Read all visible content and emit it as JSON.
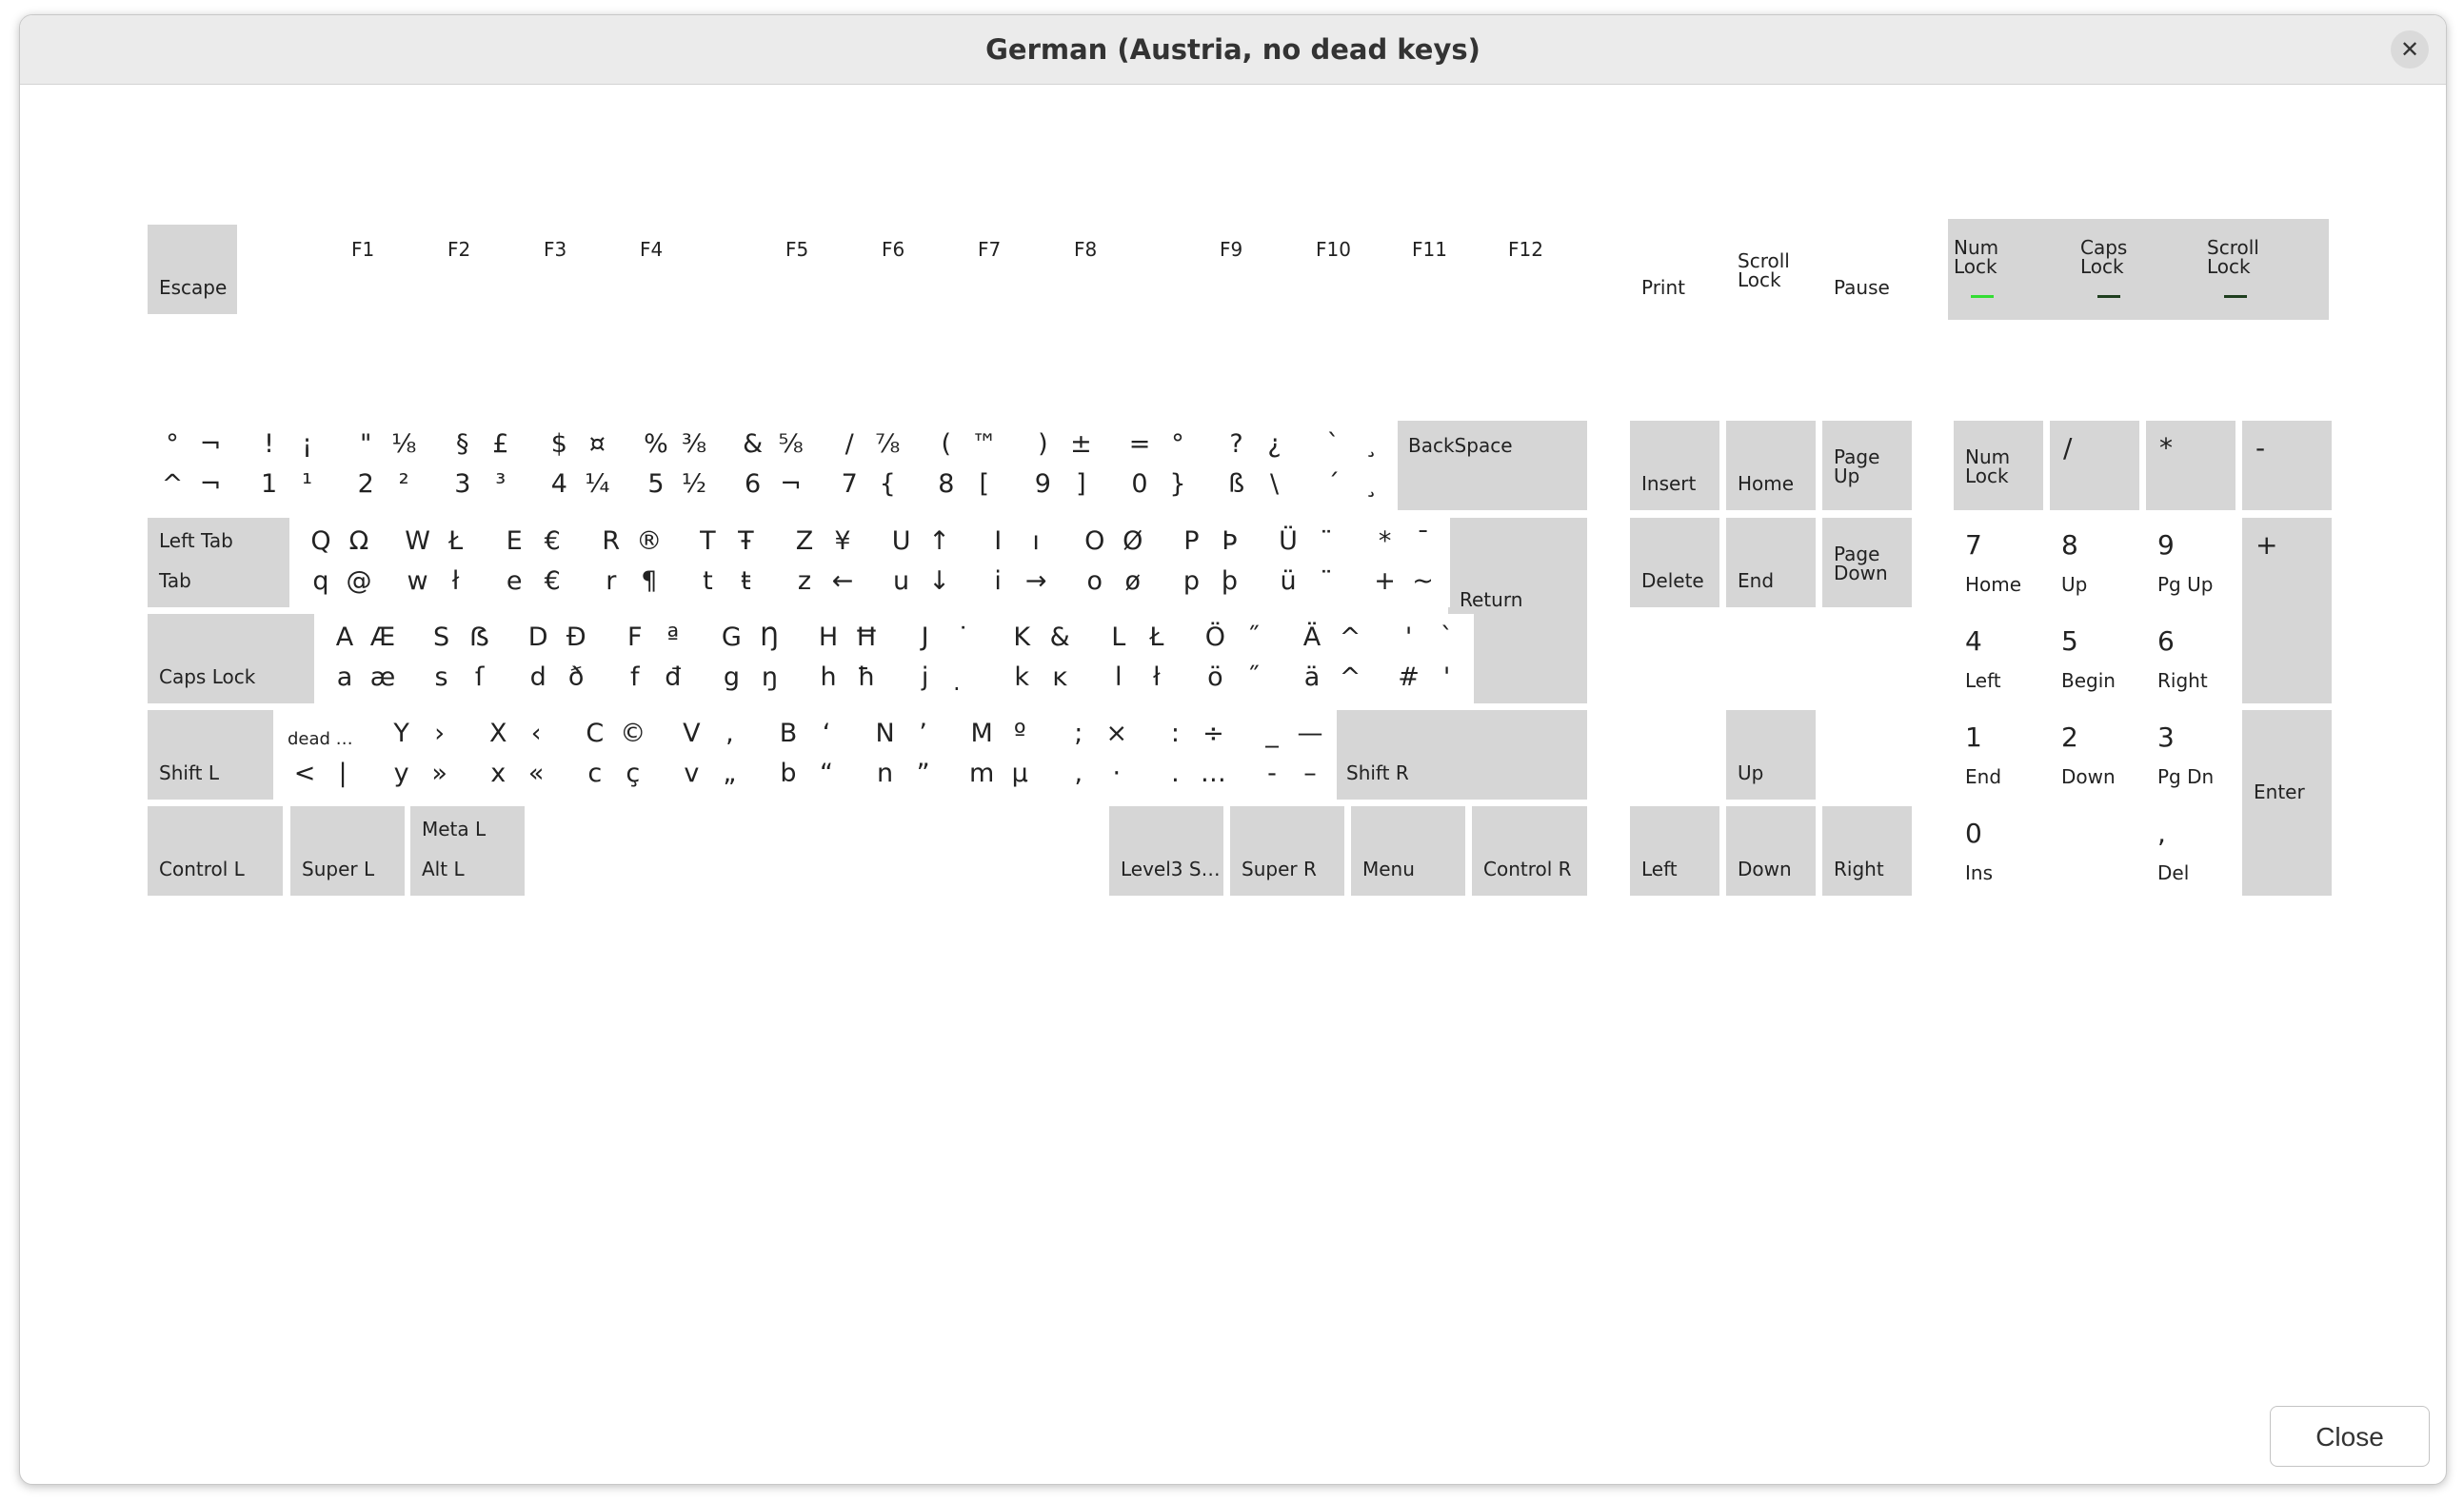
{
  "window": {
    "title": "German (Austria, no dead keys)",
    "close_icon": "close-icon"
  },
  "colors": {
    "key_gray": "#d6d6d6",
    "led_on": "#33dd33",
    "led_off": "#1f3f1f",
    "titlebar": "#ebebeb"
  },
  "buttons": {
    "close": "Close"
  },
  "indicators": {
    "num_lock": {
      "label1": "Num",
      "label2": "Lock",
      "on": true
    },
    "caps_lock": {
      "label1": "Caps",
      "label2": "Lock",
      "on": false
    },
    "scroll_lock": {
      "label1": "Scroll",
      "label2": "Lock",
      "on": false
    }
  },
  "keys": [
    {
      "id": "esc",
      "label": "Escape"
    },
    {
      "id": "f1",
      "label": "F1"
    },
    {
      "id": "f2",
      "label": "F2"
    },
    {
      "id": "f3",
      "label": "F3"
    },
    {
      "id": "f4",
      "label": "F4"
    },
    {
      "id": "f5",
      "label": "F5"
    },
    {
      "id": "f6",
      "label": "F6"
    },
    {
      "id": "f7",
      "label": "F7"
    },
    {
      "id": "f8",
      "label": "F8"
    },
    {
      "id": "f9",
      "label": "F9"
    },
    {
      "id": "f10",
      "label": "F10"
    },
    {
      "id": "f11",
      "label": "F11"
    },
    {
      "id": "f12",
      "label": "F12"
    },
    {
      "id": "print",
      "label": "Print"
    },
    {
      "id": "scroll",
      "label": "Scroll Lock"
    },
    {
      "id": "pause",
      "label": "Pause"
    },
    {
      "id": "grave",
      "g": [
        "°",
        "¬",
        "^",
        "¬"
      ]
    },
    {
      "id": "k1",
      "g": [
        "!",
        "¡",
        "1",
        "¹"
      ]
    },
    {
      "id": "k2",
      "g": [
        "\"",
        "⅛",
        "2",
        "²"
      ]
    },
    {
      "id": "k3",
      "g": [
        "§",
        "£",
        "3",
        "³"
      ]
    },
    {
      "id": "k4",
      "g": [
        "$",
        "¤",
        "4",
        "¼"
      ]
    },
    {
      "id": "k5",
      "g": [
        "%",
        "⅜",
        "5",
        "½"
      ]
    },
    {
      "id": "k6",
      "g": [
        "&",
        "⅝",
        "6",
        "¬"
      ]
    },
    {
      "id": "k7",
      "g": [
        "/",
        "⅞",
        "7",
        "{"
      ]
    },
    {
      "id": "k8",
      "g": [
        "(",
        "™",
        "8",
        "["
      ]
    },
    {
      "id": "k9",
      "g": [
        ")",
        "±",
        "9",
        "]"
      ]
    },
    {
      "id": "k0",
      "g": [
        "=",
        "°",
        "0",
        "}"
      ]
    },
    {
      "id": "ss",
      "g": [
        "?",
        "¿",
        "ß",
        "\\"
      ]
    },
    {
      "id": "acute",
      "g": [
        "`",
        "¸",
        "´",
        "¸"
      ]
    },
    {
      "id": "bksp",
      "label": "BackSpace"
    },
    {
      "id": "tab",
      "labels": [
        "Left Tab",
        "Tab"
      ]
    },
    {
      "id": "q",
      "g": [
        "Q",
        "Ω",
        "q",
        "@"
      ]
    },
    {
      "id": "w",
      "g": [
        "W",
        "Ł",
        "w",
        "ł"
      ]
    },
    {
      "id": "e",
      "g": [
        "E",
        "€",
        "e",
        "€"
      ]
    },
    {
      "id": "r",
      "g": [
        "R",
        "®",
        "r",
        "¶"
      ]
    },
    {
      "id": "t",
      "g": [
        "T",
        "Ŧ",
        "t",
        "ŧ"
      ]
    },
    {
      "id": "z",
      "g": [
        "Z",
        "¥",
        "z",
        "←"
      ]
    },
    {
      "id": "u",
      "g": [
        "U",
        "↑",
        "u",
        "↓"
      ]
    },
    {
      "id": "i",
      "g": [
        "I",
        "ı",
        "i",
        "→"
      ]
    },
    {
      "id": "o",
      "g": [
        "O",
        "Ø",
        "o",
        "ø"
      ]
    },
    {
      "id": "p",
      "g": [
        "P",
        "Þ",
        "p",
        "þ"
      ]
    },
    {
      "id": "ue",
      "g": [
        "Ü",
        "¨",
        "ü",
        "¨"
      ]
    },
    {
      "id": "plus",
      "g": [
        "*",
        "¯",
        "+",
        "~"
      ]
    },
    {
      "id": "ret",
      "label": "Return"
    },
    {
      "id": "caps",
      "label": "Caps Lock"
    },
    {
      "id": "a",
      "g": [
        "A",
        "Æ",
        "a",
        "æ"
      ]
    },
    {
      "id": "s",
      "g": [
        "S",
        "ẞ",
        "s",
        "ſ"
      ]
    },
    {
      "id": "d",
      "g": [
        "D",
        "Đ",
        "d",
        "ð"
      ]
    },
    {
      "id": "f",
      "g": [
        "F",
        "ª",
        "f",
        "đ"
      ]
    },
    {
      "id": "gk",
      "g": [
        "G",
        "Ŋ",
        "g",
        "ŋ"
      ]
    },
    {
      "id": "h",
      "g": [
        "H",
        "Ħ",
        "h",
        "ħ"
      ]
    },
    {
      "id": "j",
      "g": [
        "J",
        "˙",
        "j",
        "̣"
      ]
    },
    {
      "id": "k",
      "g": [
        "K",
        "&",
        "k",
        "ĸ"
      ]
    },
    {
      "id": "l",
      "g": [
        "L",
        "Ł",
        "l",
        "ł"
      ]
    },
    {
      "id": "oe",
      "g": [
        "Ö",
        "˝",
        "ö",
        "˝"
      ]
    },
    {
      "id": "ae",
      "g": [
        "Ä",
        "^",
        "ä",
        "^"
      ]
    },
    {
      "id": "hash",
      "g": [
        "'",
        "`",
        "#",
        "'"
      ]
    },
    {
      "id": "lshift",
      "label": "Shift L"
    },
    {
      "id": "lsgt",
      "g": [
        "dead …",
        "",
        "<",
        "|"
      ]
    },
    {
      "id": "y",
      "g": [
        "Y",
        "›",
        "y",
        "»"
      ]
    },
    {
      "id": "x",
      "g": [
        "X",
        "‹",
        "x",
        "«"
      ]
    },
    {
      "id": "c",
      "g": [
        "C",
        "©",
        "c",
        "ç"
      ]
    },
    {
      "id": "v",
      "g": [
        "V",
        ",",
        "v",
        "„"
      ]
    },
    {
      "id": "b",
      "g": [
        "B",
        "‘",
        "b",
        "“"
      ]
    },
    {
      "id": "n",
      "g": [
        "N",
        "’",
        "n",
        "”"
      ]
    },
    {
      "id": "m",
      "g": [
        "M",
        "º",
        "m",
        "µ"
      ]
    },
    {
      "id": "comma",
      "g": [
        ";",
        "×",
        ",",
        "·"
      ]
    },
    {
      "id": "period",
      "g": [
        ":",
        "÷",
        ".",
        "…"
      ]
    },
    {
      "id": "minus",
      "g": [
        "_",
        "—",
        "-",
        "–"
      ]
    },
    {
      "id": "rshift",
      "label": "Shift R"
    },
    {
      "id": "lctrl",
      "label": "Control L"
    },
    {
      "id": "lsuper",
      "label": "Super L"
    },
    {
      "id": "lalt",
      "labels": [
        "Meta L",
        "Alt L"
      ]
    },
    {
      "id": "space",
      "label": ""
    },
    {
      "id": "altgr",
      "label": "Level3 S…"
    },
    {
      "id": "rsuper",
      "label": "Super R"
    },
    {
      "id": "menu",
      "label": "Menu"
    },
    {
      "id": "rctrl",
      "label": "Control R"
    },
    {
      "id": "ins",
      "label": "Insert"
    },
    {
      "id": "home",
      "label": "Home"
    },
    {
      "id": "pgup",
      "labels": [
        "Page",
        "Up"
      ]
    },
    {
      "id": "del",
      "label": "Delete"
    },
    {
      "id": "end",
      "label": "End"
    },
    {
      "id": "pgdn",
      "labels": [
        "Page",
        "Down"
      ]
    },
    {
      "id": "up",
      "label": "Up"
    },
    {
      "id": "left",
      "label": "Left"
    },
    {
      "id": "down",
      "label": "Down"
    },
    {
      "id": "right",
      "label": "Right"
    },
    {
      "id": "numlock",
      "labels": [
        "Num",
        "Lock"
      ]
    },
    {
      "id": "kpdiv",
      "label": "/"
    },
    {
      "id": "kpmul",
      "label": "*"
    },
    {
      "id": "kpsub",
      "label": "-"
    },
    {
      "id": "kp7",
      "num": "7",
      "sub": "Home"
    },
    {
      "id": "kp8",
      "num": "8",
      "sub": "Up"
    },
    {
      "id": "kp9",
      "num": "9",
      "sub": "Pg Up"
    },
    {
      "id": "kpadd",
      "label": "+"
    },
    {
      "id": "kp4",
      "num": "4",
      "sub": "Left"
    },
    {
      "id": "kp5",
      "num": "5",
      "sub": "Begin"
    },
    {
      "id": "kp6",
      "num": "6",
      "sub": "Right"
    },
    {
      "id": "kp1",
      "num": "1",
      "sub": "End"
    },
    {
      "id": "kp2",
      "num": "2",
      "sub": "Down"
    },
    {
      "id": "kp3",
      "num": "3",
      "sub": "Pg Dn"
    },
    {
      "id": "kpenter",
      "label": "Enter"
    },
    {
      "id": "kp0",
      "num": "0",
      "sub": "Ins"
    },
    {
      "id": "kpdec",
      "num": ",",
      "sub": "Del"
    }
  ]
}
